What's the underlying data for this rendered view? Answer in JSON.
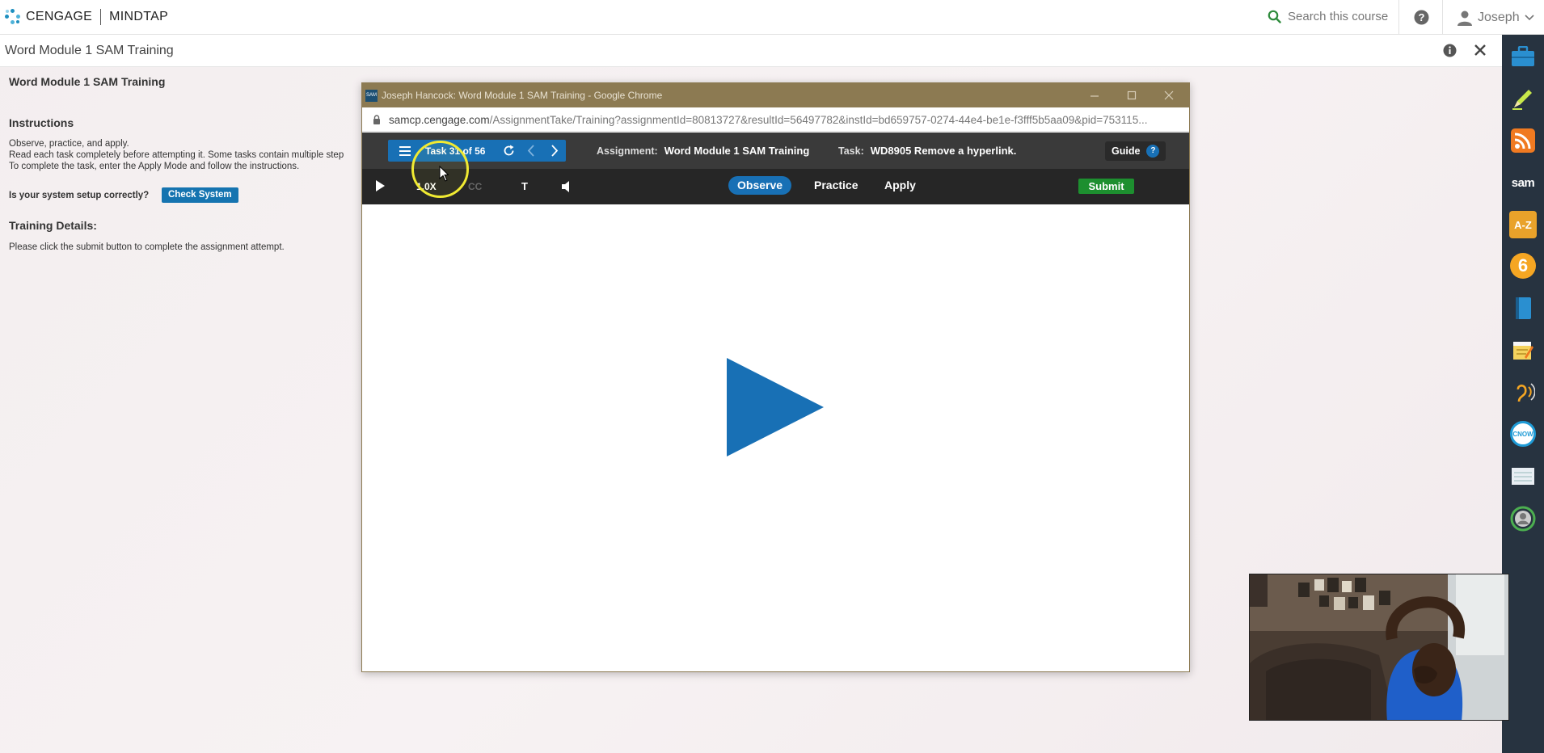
{
  "topbar": {
    "brand_left": "CENGAGE",
    "brand_right": "MINDTAP",
    "search_placeholder": "Search this course",
    "user_name": "Joseph"
  },
  "subheader": {
    "title": "Word Module 1 SAM Training"
  },
  "left_panel": {
    "heading": "Word Module 1 SAM Training",
    "instructions_heading": "Instructions",
    "instructions_lines": [
      "Observe, practice, and apply.",
      "Read each task completely before attempting it. Some tasks contain multiple step",
      "To complete the task, enter the Apply Mode and follow the instructions."
    ],
    "system_question": "Is your system setup correctly?",
    "check_system_label": "Check System",
    "training_details_heading": "Training Details:",
    "training_details_text": "Please click the submit button to complete the assignment attempt."
  },
  "popup": {
    "window_title": "Joseph Hancock: Word Module 1 SAM Training - Google Chrome",
    "favicon_text": "SAM",
    "url_host": "samcp.cengage.com",
    "url_path": "/AssignmentTake/Training?assignmentId=80813727&resultId=56497782&instId=bd659757-0274-44e4-be1e-f3fff5b5aa09&pid=753115...",
    "task_counter": "Task 31 of 56",
    "assignment_label": "Assignment:",
    "assignment_name": "Word Module 1 SAM Training",
    "task_label": "Task:",
    "task_name": "WD8905 Remove a hyperlink.",
    "guide_label": "Guide",
    "guide_q": "?",
    "speed": "1.0X",
    "cc": "CC",
    "text_toggle": "T",
    "modes": [
      "Observe",
      "Practice",
      "Apply"
    ],
    "active_mode": "Observe",
    "submit_label": "Submit"
  },
  "rightbar_icons": [
    {
      "name": "briefcase-icon",
      "color": "#2a8fd0"
    },
    {
      "name": "pencil-icon",
      "color": "#c7e84a"
    },
    {
      "name": "rss-icon",
      "color": "#f07a21"
    },
    {
      "name": "sam-icon",
      "color": "#ffffff",
      "text": "sam"
    },
    {
      "name": "dictionary-icon",
      "color": "#e9a22a",
      "text": "A-Z"
    },
    {
      "name": "number-six-icon",
      "color": "#f5a623",
      "text": "6"
    },
    {
      "name": "book-icon",
      "color": "#2a8fd0"
    },
    {
      "name": "notes-icon",
      "color": "#f4d35e"
    },
    {
      "name": "readspeaker-icon",
      "color": "#f5a623"
    },
    {
      "name": "cnow-icon",
      "color": "#1f9bd6",
      "text": "CNOW"
    },
    {
      "name": "notebook-icon",
      "color": "#e8eef3"
    },
    {
      "name": "profile-icon",
      "color": "#4caf50"
    }
  ],
  "colors": {
    "accent_blue": "#1870b5",
    "submit_green": "#1d8f2f",
    "chrome_title": "#8c7a52",
    "sidebar": "#273340"
  }
}
